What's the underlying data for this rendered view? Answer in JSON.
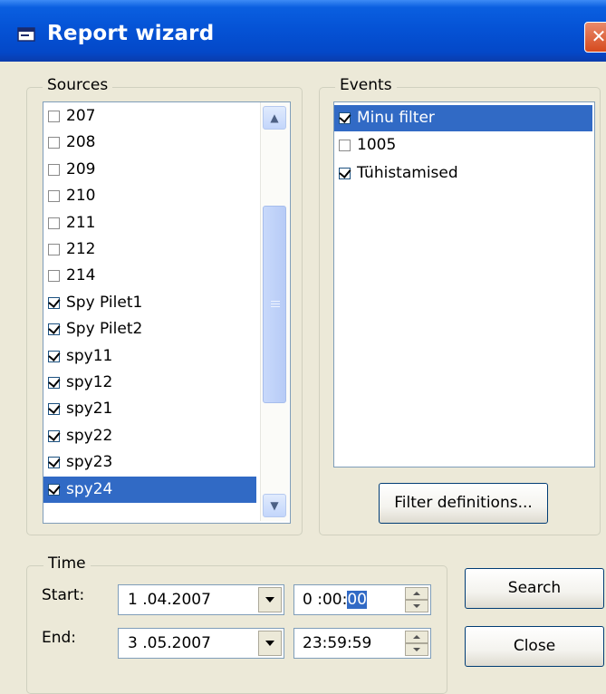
{
  "window": {
    "title": "Report wizard",
    "close_glyph": "✕"
  },
  "sources": {
    "label": "Sources",
    "items": [
      {
        "label": "207",
        "checked": false,
        "selected": false
      },
      {
        "label": "208",
        "checked": false,
        "selected": false
      },
      {
        "label": "209",
        "checked": false,
        "selected": false
      },
      {
        "label": "210",
        "checked": false,
        "selected": false
      },
      {
        "label": "211",
        "checked": false,
        "selected": false
      },
      {
        "label": "212",
        "checked": false,
        "selected": false
      },
      {
        "label": "214",
        "checked": false,
        "selected": false
      },
      {
        "label": "Spy Pilet1",
        "checked": true,
        "selected": false
      },
      {
        "label": "Spy Pilet2",
        "checked": true,
        "selected": false
      },
      {
        "label": "spy11",
        "checked": true,
        "selected": false
      },
      {
        "label": "spy12",
        "checked": true,
        "selected": false
      },
      {
        "label": "spy21",
        "checked": true,
        "selected": false
      },
      {
        "label": "spy22",
        "checked": true,
        "selected": false
      },
      {
        "label": "spy23",
        "checked": true,
        "selected": false
      },
      {
        "label": "spy24",
        "checked": true,
        "selected": true
      }
    ]
  },
  "events": {
    "label": "Events",
    "items": [
      {
        "label": "Minu filter",
        "checked": true,
        "selected": true
      },
      {
        "label": "1005",
        "checked": false,
        "selected": false
      },
      {
        "label": "Tühistamised",
        "checked": true,
        "selected": false
      }
    ],
    "filter_button": "Filter definitions..."
  },
  "time": {
    "label": "Time",
    "start_label": "Start:",
    "end_label": "End:",
    "start_date": "1 .04.2007",
    "start_time_prefix": "0 :00:",
    "start_time_selected": "00",
    "end_date": "3 .05.2007",
    "end_time": "23:59:59"
  },
  "buttons": {
    "search": "Search",
    "close": "Close"
  },
  "colors": {
    "selection": "#316ac5",
    "titlebar": "#0553d6",
    "dialog_bg": "#ECE9D8"
  }
}
